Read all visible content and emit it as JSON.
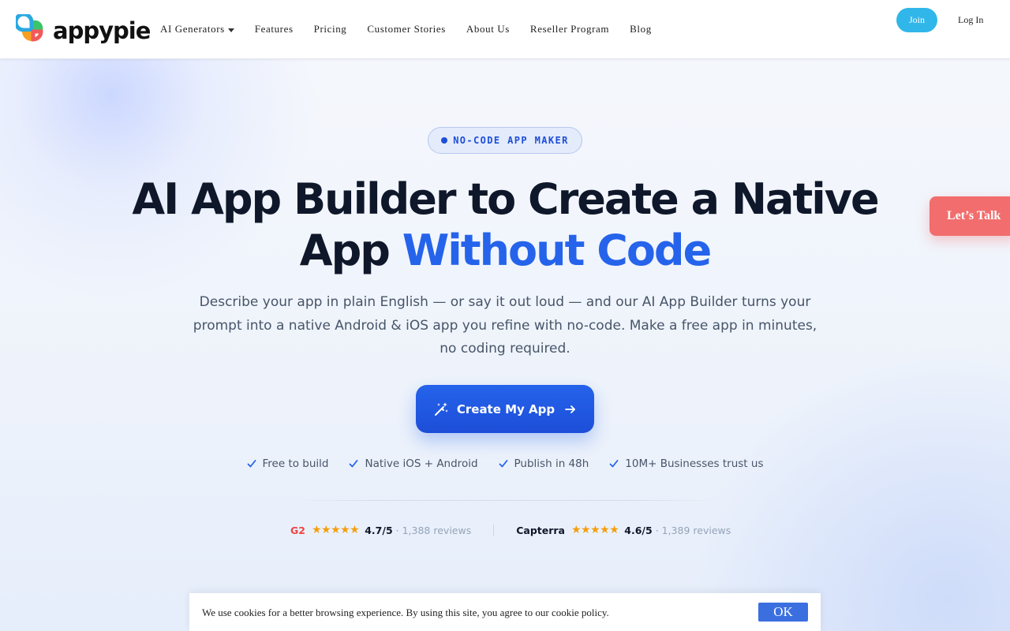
{
  "header": {
    "logo_text": "appypie",
    "nav": [
      {
        "label": "AI Generators",
        "has_dropdown": true
      },
      {
        "label": "Features"
      },
      {
        "label": "Pricing"
      },
      {
        "label": "Customer Stories"
      },
      {
        "label": "About Us"
      },
      {
        "label": "Reseller Program"
      },
      {
        "label": "Blog"
      }
    ],
    "join_label": "Join",
    "login_label": "Log In"
  },
  "hero": {
    "badge": "NO-CODE APP MAKER",
    "headline_line1": "AI App Builder to Create a Native",
    "headline_line2_plain": "App",
    "headline_line2_accent": "Without Code",
    "subtext": "Describe your app in plain English — or say it out loud — and our AI App Builder turns your prompt into a native Android & iOS app you refine with no-code. Make a free app in minutes, no coding required.",
    "cta_label": "Create My App",
    "checks": [
      "Free to build",
      "Native iOS + Android",
      "Publish in 48h",
      "10M+ Businesses trust us"
    ]
  },
  "ratings": [
    {
      "source": "G2",
      "stars": "★★★★★",
      "score": "4.7/5",
      "reviews": "· 1,388 reviews"
    },
    {
      "source": "Capterra",
      "stars": "★★★★★",
      "score": "4.6/5",
      "reviews": "· 1,389 reviews"
    }
  ],
  "side_tab": {
    "label": "Let’s Talk"
  },
  "cookie": {
    "text": "We use cookies for a better browsing experience. By using this site, you agree to our cookie policy.",
    "ok_label": "OK"
  },
  "colors": {
    "accent": "#2563eb",
    "join_button": "#31b6e9",
    "lets_talk": "#f26d6d",
    "g2": "#ef4444",
    "stars": "#f59e0b",
    "cookie_ok": "#3b6fe0"
  }
}
